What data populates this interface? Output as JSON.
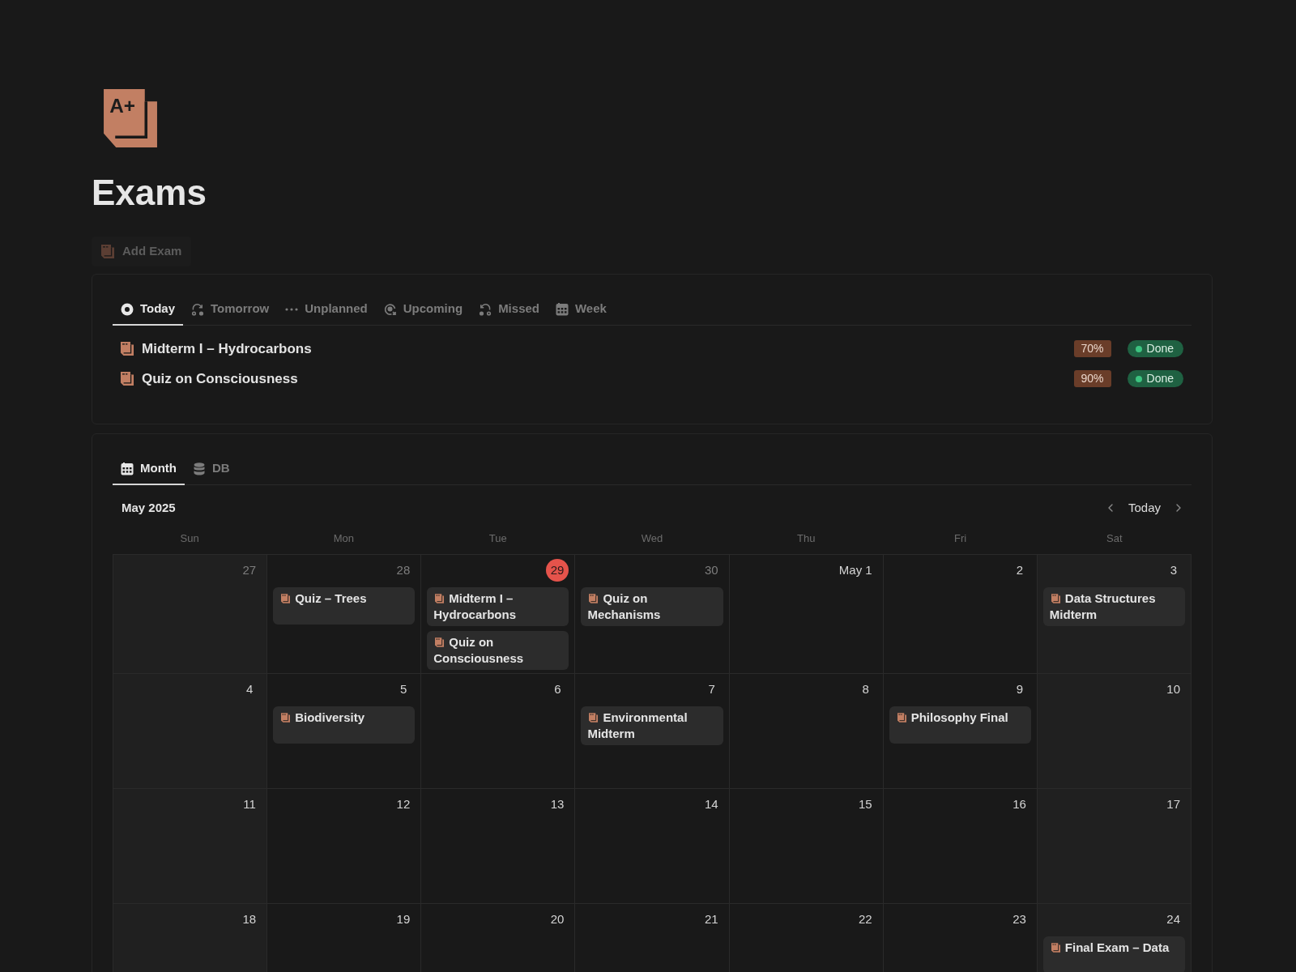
{
  "page": {
    "icon_text": "A+",
    "title": "Exams",
    "add_button": "Add Exam"
  },
  "exam_views": {
    "tabs": [
      {
        "label": "Today",
        "kind": "today",
        "selected": true
      },
      {
        "label": "Tomorrow",
        "kind": "tomorrow",
        "selected": false
      },
      {
        "label": "Unplanned",
        "kind": "unplanned",
        "selected": false
      },
      {
        "label": "Upcoming",
        "kind": "upcoming",
        "selected": false
      },
      {
        "label": "Missed",
        "kind": "missed",
        "selected": false
      },
      {
        "label": "Week",
        "kind": "week",
        "selected": false
      }
    ],
    "rows": [
      {
        "title": "Midterm I – Hydrocarbons",
        "score": "70%",
        "status": "Done"
      },
      {
        "title": "Quiz on Consciousness",
        "score": "90%",
        "status": "Done"
      }
    ]
  },
  "calendar": {
    "tabs": [
      {
        "label": "Month",
        "kind": "month",
        "selected": true
      },
      {
        "label": "DB",
        "kind": "database",
        "selected": false
      }
    ],
    "month_label": "May 2025",
    "today_button": "Today",
    "weekdays": [
      "Sun",
      "Mon",
      "Tue",
      "Wed",
      "Thu",
      "Fri",
      "Sat"
    ],
    "weeks": [
      {
        "days": [
          {
            "date": "27",
            "in_month": false,
            "today": false
          },
          {
            "date": "28",
            "in_month": false,
            "today": false,
            "events": [
              {
                "title": "Quiz – Trees"
              }
            ]
          },
          {
            "date": "29",
            "in_month": false,
            "today": true,
            "events": [
              {
                "title": "Midterm I – Hydrocarbons"
              },
              {
                "title": "Quiz on Consciousness"
              }
            ]
          },
          {
            "date": "30",
            "in_month": false,
            "today": false,
            "events": [
              {
                "title": "Quiz on Mechanisms"
              }
            ]
          },
          {
            "date": "May 1",
            "in_month": true,
            "today": false
          },
          {
            "date": "2",
            "in_month": true,
            "today": false
          },
          {
            "date": "3",
            "in_month": true,
            "today": false,
            "events": [
              {
                "title": "Data Structures Midterm"
              }
            ]
          }
        ]
      },
      {
        "days": [
          {
            "date": "4",
            "in_month": true,
            "today": false
          },
          {
            "date": "5",
            "in_month": true,
            "today": false,
            "events": [
              {
                "title": "Biodiversity"
              }
            ]
          },
          {
            "date": "6",
            "in_month": true,
            "today": false
          },
          {
            "date": "7",
            "in_month": true,
            "today": false,
            "events": [
              {
                "title": "Environmental Midterm"
              }
            ]
          },
          {
            "date": "8",
            "in_month": true,
            "today": false
          },
          {
            "date": "9",
            "in_month": true,
            "today": false,
            "events": [
              {
                "title": "Philosophy Final"
              }
            ]
          },
          {
            "date": "10",
            "in_month": true,
            "today": false
          }
        ]
      },
      {
        "days": [
          {
            "date": "11",
            "in_month": true,
            "today": false
          },
          {
            "date": "12",
            "in_month": true,
            "today": false
          },
          {
            "date": "13",
            "in_month": true,
            "today": false
          },
          {
            "date": "14",
            "in_month": true,
            "today": false
          },
          {
            "date": "15",
            "in_month": true,
            "today": false
          },
          {
            "date": "16",
            "in_month": true,
            "today": false
          },
          {
            "date": "17",
            "in_month": true,
            "today": false
          }
        ]
      },
      {
        "days": [
          {
            "date": "18",
            "in_month": true,
            "today": false
          },
          {
            "date": "19",
            "in_month": true,
            "today": false
          },
          {
            "date": "20",
            "in_month": true,
            "today": false
          },
          {
            "date": "21",
            "in_month": true,
            "today": false
          },
          {
            "date": "22",
            "in_month": true,
            "today": false
          },
          {
            "date": "23",
            "in_month": true,
            "today": false
          },
          {
            "date": "24",
            "in_month": true,
            "today": false,
            "events": [
              {
                "title": "Final Exam – Data"
              }
            ]
          }
        ]
      }
    ]
  }
}
